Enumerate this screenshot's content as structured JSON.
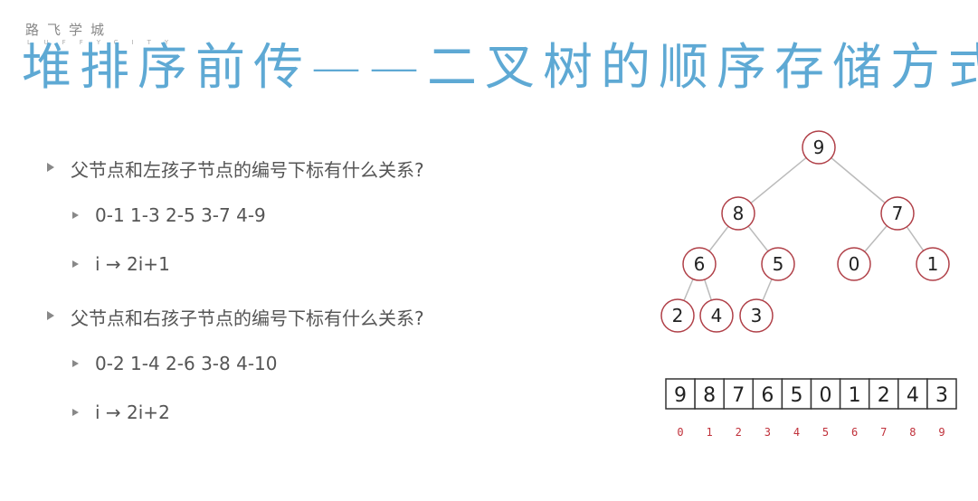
{
  "logo": {
    "name": "路飞学城",
    "sub": "LUFFYCITY"
  },
  "title": "堆排序前传——二叉树的顺序存储方式",
  "bullets": [
    {
      "text": "父节点和左孩子节点的编号下标有什么关系?",
      "sub": [
        "0-1 1-3 2-5 3-7 4-9",
        "i → 2i+1"
      ]
    },
    {
      "text": "父节点和右孩子节点的编号下标有什么关系?",
      "sub": [
        "0-2 1-4 2-6 3-8 4-10",
        "i → 2i+2"
      ]
    }
  ],
  "tree": {
    "nodes": [
      "9",
      "8",
      "7",
      "6",
      "5",
      "0",
      "1",
      "2",
      "4",
      "3"
    ]
  },
  "array": {
    "values": [
      "9",
      "8",
      "7",
      "6",
      "5",
      "0",
      "1",
      "2",
      "4",
      "3"
    ],
    "indices": [
      "0",
      "1",
      "2",
      "3",
      "4",
      "5",
      "6",
      "7",
      "8",
      "9"
    ]
  },
  "colors": {
    "title": "#5ea9d4",
    "node_border": "#b04048",
    "index": "#c0303a"
  }
}
